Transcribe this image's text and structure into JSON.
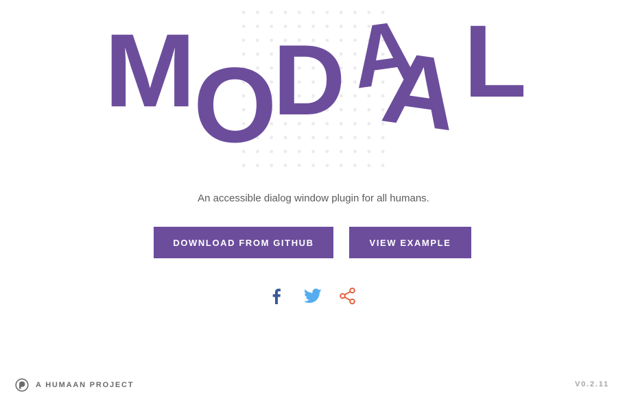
{
  "hero": {
    "logo_letters": [
      "M",
      "O",
      "D",
      "A",
      "A",
      "L"
    ],
    "tagline": "An accessible dialog window plugin for all humans."
  },
  "actions": {
    "download_label": "DOWNLOAD FROM GITHUB",
    "example_label": "VIEW EXAMPLE"
  },
  "social": {
    "icons": [
      "facebook-icon",
      "twitter-icon",
      "share-icon"
    ]
  },
  "footer": {
    "project_label": "A HUMAAN PROJECT",
    "version": "V0.2.11"
  },
  "colors": {
    "brand_purple": "#6c4d9c",
    "facebook_blue": "#3b5998",
    "twitter_blue": "#55acee",
    "share_orange": "#e4633e",
    "text_gray": "#5b5b5b",
    "muted_gray": "#a5a5a5"
  }
}
